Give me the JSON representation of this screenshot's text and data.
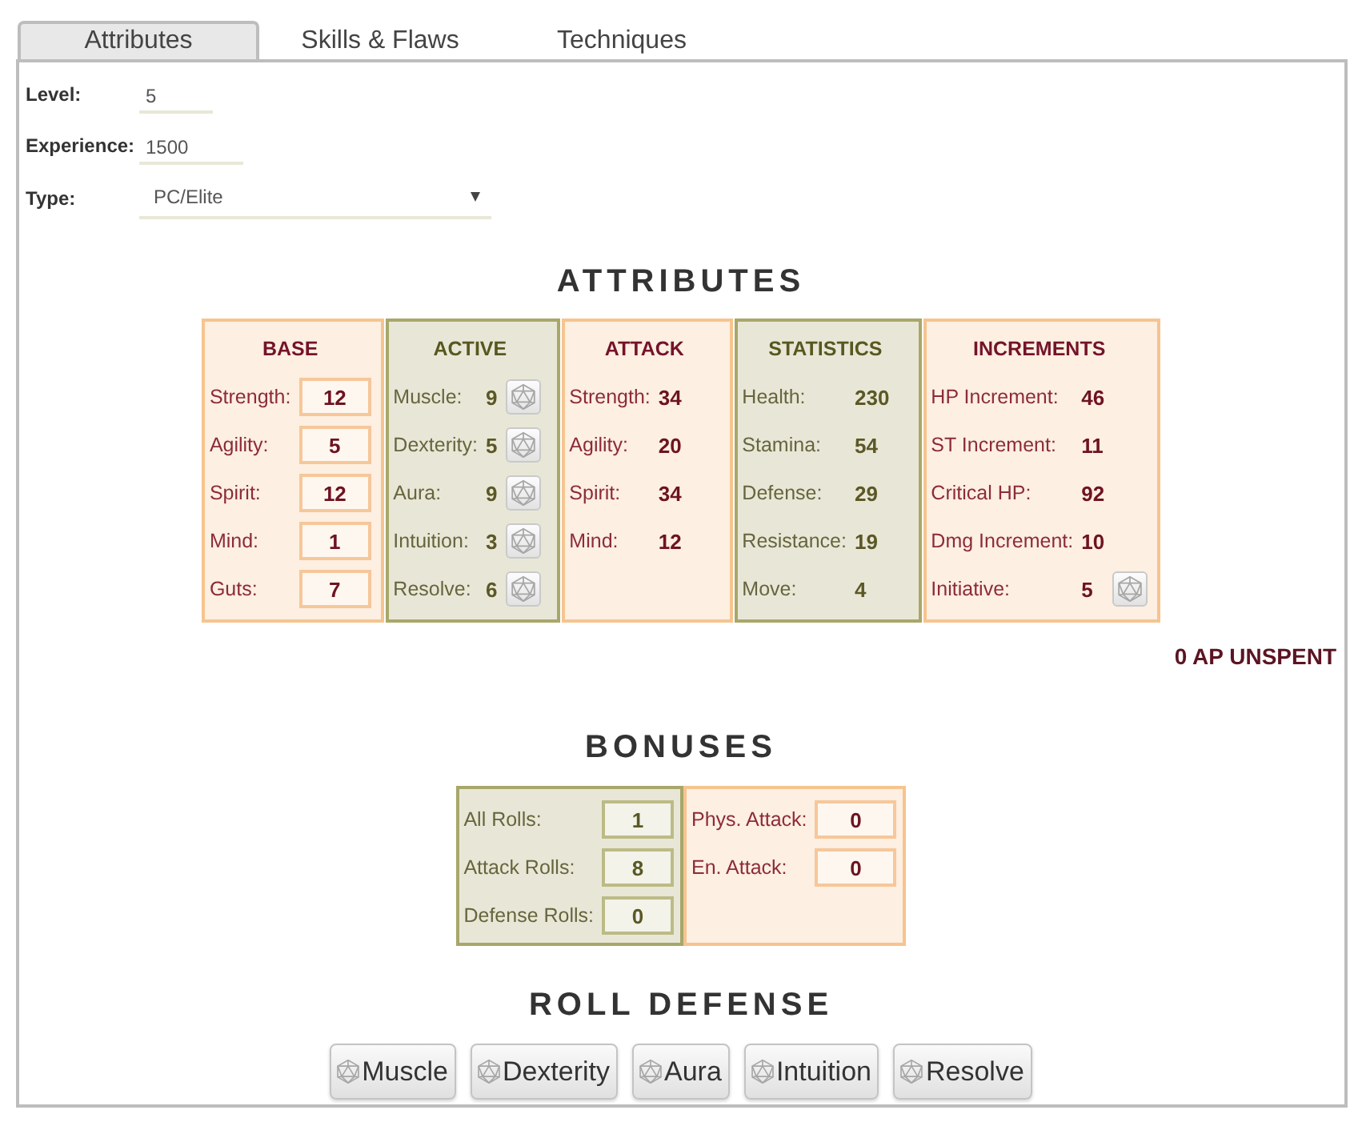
{
  "tabs": [
    {
      "label": "Attributes",
      "selected": true
    },
    {
      "label": "Skills & Flaws",
      "selected": false
    },
    {
      "label": "Techniques",
      "selected": false
    }
  ],
  "character": [
    {
      "kind": "text",
      "label": "Level:",
      "value": "5"
    },
    {
      "kind": "text",
      "label": "Experience:",
      "value": "1500"
    },
    {
      "kind": "select",
      "label": "Type:",
      "value": "PC/Elite"
    }
  ],
  "attributes": {
    "heading": "ATTRIBUTES",
    "columns": [
      {
        "title": "BASE",
        "color": "#f6c48f",
        "kind": "input",
        "rows": [
          {
            "label": "Strength:",
            "value": "12"
          },
          {
            "label": "Agility:",
            "value": "5"
          },
          {
            "label": "Spirit:",
            "value": "12"
          },
          {
            "label": "Mind:",
            "value": "1"
          },
          {
            "label": "Guts:",
            "value": "7"
          }
        ]
      },
      {
        "title": "ACTIVE",
        "color": "#a8a76a",
        "kind": "plain",
        "rows": [
          {
            "label": "Muscle:",
            "value": "9",
            "roll": true
          },
          {
            "label": "Dexterity:",
            "value": "5",
            "roll": true
          },
          {
            "label": "Aura:",
            "value": "9",
            "roll": true
          },
          {
            "label": "Intuition:",
            "value": "3",
            "roll": true
          },
          {
            "label": "Resolve:",
            "value": "6",
            "roll": true
          }
        ]
      },
      {
        "title": "ATTACK",
        "color": "#f6c48f",
        "kind": "plain",
        "rows": [
          {
            "label": "Strength:",
            "value": "34"
          },
          {
            "label": "Agility:",
            "value": "20"
          },
          {
            "label": "Spirit:",
            "value": "34"
          },
          {
            "label": "Mind:",
            "value": "12"
          }
        ]
      },
      {
        "title": "STATISTICS",
        "color": "#a8a76a",
        "kind": "plain",
        "rows": [
          {
            "label": "Health:",
            "value": "230"
          },
          {
            "label": "Stamina:",
            "value": "54"
          },
          {
            "label": "Defense:",
            "value": "29"
          },
          {
            "label": "Resistance:",
            "value": "19"
          },
          {
            "label": "Move:",
            "value": "4"
          }
        ]
      },
      {
        "title": "INCREMENTS",
        "color": "#f6c48f",
        "kind": "plain",
        "rows": [
          {
            "label": "HP Increment:",
            "value": "46",
            "roll": false
          },
          {
            "label": "ST Increment:",
            "value": "11",
            "roll": false
          },
          {
            "label": "Critical HP:",
            "value": "92",
            "roll": false
          },
          {
            "label": "Dmg Increment:",
            "value": "10",
            "roll": false
          },
          {
            "label": "Initiative:",
            "value": "5",
            "roll": true
          }
        ]
      }
    ],
    "unspent": "0 AP UNSPENT"
  },
  "bonuses": {
    "heading": "BONUSES",
    "groups": [
      {
        "color": "#a8a76a",
        "rows": [
          {
            "label": "All Rolls:",
            "value": "1"
          },
          {
            "label": "Attack Rolls:",
            "value": "8"
          },
          {
            "label": "Defense Rolls:",
            "value": "0"
          }
        ]
      },
      {
        "color": "#f6c48f",
        "rows": [
          {
            "label": "Phys. Attack:",
            "value": "0"
          },
          {
            "label": "En. Attack:",
            "value": "0"
          }
        ]
      }
    ]
  },
  "roll_defense": {
    "heading": "ROLL DEFENSE",
    "buttons": [
      "Muscle",
      "Dexterity",
      "Aura",
      "Intuition",
      "Resolve"
    ]
  }
}
